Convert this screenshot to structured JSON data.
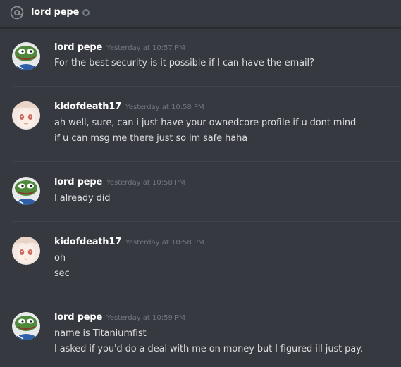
{
  "channel": {
    "name": "lord pepe"
  },
  "messages": [
    {
      "author": "lord pepe",
      "avatar": "pepe-frog-avatar",
      "time": "Yesterday at 10:57 PM",
      "lines": [
        "For the best security is it possible if I can have the email?"
      ]
    },
    {
      "author": "kidofdeath17",
      "avatar": "anime-girl-avatar",
      "time": "Yesterday at 10:58 PM",
      "lines": [
        "ah well, sure, can i just have your ownedcore profile if u dont mind",
        "if u can msg me there just so im safe haha"
      ]
    },
    {
      "author": "lord pepe",
      "avatar": "pepe-frog-avatar",
      "time": "Yesterday at 10:58 PM",
      "lines": [
        "I already did"
      ]
    },
    {
      "author": "kidofdeath17",
      "avatar": "anime-girl-avatar",
      "time": "Yesterday at 10:58 PM",
      "lines": [
        "oh",
        "sec"
      ]
    },
    {
      "author": "lord pepe",
      "avatar": "pepe-frog-avatar",
      "time": "Yesterday at 10:59 PM",
      "lines": [
        "name is Titaniumfist",
        "I asked if you'd do a deal with me on money but I figured ill just pay."
      ]
    }
  ]
}
